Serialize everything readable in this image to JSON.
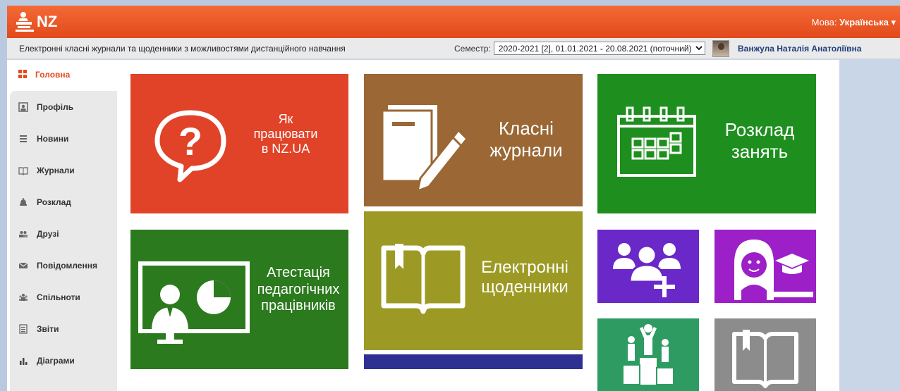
{
  "header": {
    "logo_text": "NZ",
    "language_label": "Мова:",
    "language_value": "Українська"
  },
  "subbar": {
    "subtitle": "Електронні класні журнали та щоденники з можливостями дистанційного навчання",
    "semester_label": "Семестр:",
    "semester_value": "2020-2021 [2], 01.01.2021 - 20.08.2021 (поточний)",
    "user_name": "Ванжула Наталія Анатоліївна"
  },
  "sidebar": {
    "active": {
      "label": "Головна",
      "icon": "grid-icon"
    },
    "items": [
      {
        "label": "Профіль",
        "icon": "profile-icon"
      },
      {
        "label": "Новини",
        "icon": "list-icon"
      },
      {
        "label": "Журнали",
        "icon": "book-icon"
      },
      {
        "label": "Розклад",
        "icon": "bell-icon"
      },
      {
        "label": "Друзі",
        "icon": "people-icon"
      },
      {
        "label": "Повідомлення",
        "icon": "envelope-icon"
      },
      {
        "label": "Спільноти",
        "icon": "group-icon"
      },
      {
        "label": "Звіти",
        "icon": "report-icon"
      },
      {
        "label": "Діаграми",
        "icon": "chart-icon"
      }
    ]
  },
  "tiles": {
    "howto": {
      "line1": "Як",
      "line2": "працювати",
      "line3": "в NZ.UA",
      "color": "#e04328",
      "icon": "question-bubble-icon"
    },
    "journals": {
      "line1": "Класні",
      "line2": "журнали",
      "color": "#9a6735",
      "icon": "journal-pen-icon"
    },
    "schedule": {
      "line1": "Розклад",
      "line2": "занять",
      "color": "#1e8f1e",
      "icon": "calendar-icon"
    },
    "attestation": {
      "line1": "Атестація",
      "line2": "педагогічних",
      "line3": "працівників",
      "color": "#2b7a1d",
      "icon": "presentation-icon"
    },
    "diaries": {
      "line1": "Електронні",
      "line2": "щоденники",
      "color": "#9c9a24",
      "icon": "open-book-icon"
    },
    "add_friends": {
      "color": "#6a28c9",
      "icon": "add-people-icon"
    },
    "student": {
      "color": "#9c1fc7",
      "icon": "student-icon"
    },
    "rating": {
      "color": "#2e9c62",
      "icon": "podium-icon"
    },
    "library": {
      "color": "#8c8c8c",
      "icon": "book-outline-icon"
    },
    "blue_bar": {
      "color": "#2e3192"
    }
  }
}
